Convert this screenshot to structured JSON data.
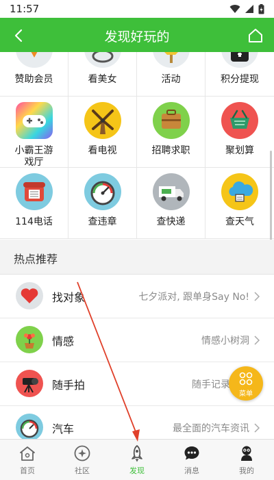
{
  "status_bar": {
    "time": "11:57"
  },
  "header": {
    "title": "发现好玩的"
  },
  "grid": {
    "rows": [
      [
        {
          "label": "赞助会员",
          "icon": "sponsor-icon"
        },
        {
          "label": "看美女",
          "icon": "beauty-icon"
        },
        {
          "label": "活动",
          "icon": "activity-icon"
        },
        {
          "label": "积分提现",
          "icon": "points-cash-icon"
        }
      ],
      [
        {
          "label": "小霸王游\n戏厅",
          "icon": "gamepad-icon"
        },
        {
          "label": "看电视",
          "icon": "windmill-tv-icon"
        },
        {
          "label": "招聘求职",
          "icon": "suitcase-icon"
        },
        {
          "label": "聚划算",
          "icon": "basket-icon"
        }
      ],
      [
        {
          "label": "114电话",
          "icon": "telephone-icon"
        },
        {
          "label": "查违章",
          "icon": "speedometer-icon"
        },
        {
          "label": "查快递",
          "icon": "truck-icon"
        },
        {
          "label": "查天气",
          "icon": "cloud-icon"
        }
      ]
    ]
  },
  "hot": {
    "title": "热点推荐",
    "items": [
      {
        "name": "找对象",
        "desc": "七夕派对, 跟单身Say No!",
        "icon": "heart-icon"
      },
      {
        "name": "情感",
        "desc": "情感小树洞",
        "icon": "flower-pot-icon"
      },
      {
        "name": "随手拍",
        "desc": "随手记录生活",
        "icon": "camera-tripod-icon"
      },
      {
        "name": "汽车",
        "desc": "最全面的汽车资讯",
        "icon": "car-gauge-icon"
      }
    ]
  },
  "fab": {
    "label": "菜单"
  },
  "tabs": [
    {
      "label": "首页",
      "icon": "home-icon"
    },
    {
      "label": "社区",
      "icon": "community-icon"
    },
    {
      "label": "发现",
      "icon": "rocket-icon",
      "active": true
    },
    {
      "label": "消息",
      "icon": "message-icon"
    },
    {
      "label": "我的",
      "icon": "profile-icon"
    }
  ],
  "colors": {
    "brand_green": "#3ebf3a",
    "fab_orange": "#f5b71a",
    "annotation_red": "#e0402a"
  }
}
